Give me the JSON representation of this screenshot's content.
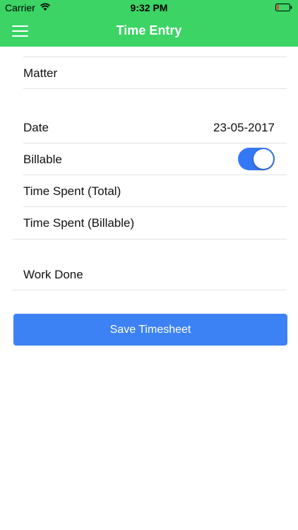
{
  "status_bar": {
    "carrier": "Carrier",
    "time": "9:32 PM",
    "battery_color": "#e74c3c"
  },
  "nav": {
    "title": "Time Entry",
    "background": "#3bd465"
  },
  "form": {
    "matter_label": "Matter",
    "date_label": "Date",
    "date_value": "23-05-2017",
    "billable_label": "Billable",
    "billable_on": true,
    "time_total_label": "Time Spent (Total)",
    "time_billable_label": "Time Spent (Billable)",
    "work_done_label": "Work Done"
  },
  "actions": {
    "save_label": "Save Timesheet",
    "save_color": "#3d82f5"
  }
}
